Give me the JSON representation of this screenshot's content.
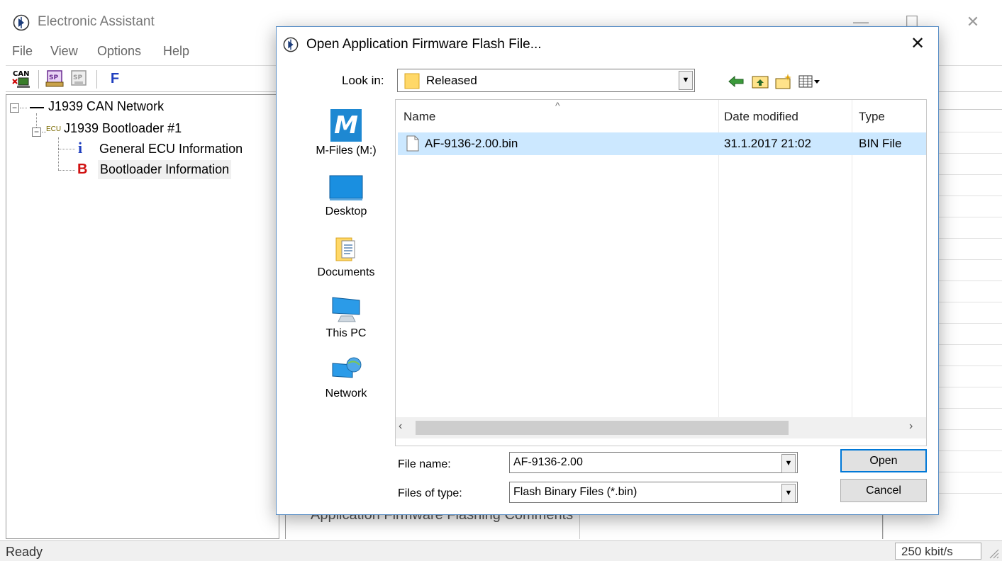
{
  "main_window": {
    "title": "Electronic Assistant",
    "menu": [
      "File",
      "View",
      "Options",
      "Help"
    ],
    "toolbar": {
      "f_button": "F"
    },
    "tree": {
      "root": "J1939 CAN Network",
      "ecu_tag": "ECU",
      "node": "J1939 Bootloader #1",
      "children": [
        {
          "icon": "i",
          "label": "General ECU Information"
        },
        {
          "icon": "B",
          "label": "Bootloader Information"
        }
      ]
    },
    "background_label": "Application Firmware Flashing Comments",
    "status": {
      "text": "Ready",
      "baud": "250 kbit/s"
    }
  },
  "dialog": {
    "title": "Open Application Firmware Flash File...",
    "look_in_label": "Look in:",
    "look_in_value": "Released",
    "places": [
      "M-Files (M:)",
      "Desktop",
      "Documents",
      "This PC",
      "Network"
    ],
    "places_m_glyph": "M",
    "columns": [
      "Name",
      "Date modified",
      "Type"
    ],
    "files": [
      {
        "name": "AF-9136-2.00.bin",
        "date": "31.1.2017 21:02",
        "type": "BIN File"
      }
    ],
    "file_name_label": "File name:",
    "file_name_value": "AF-9136-2.00",
    "file_type_label": "Files of type:",
    "file_type_value": "Flash Binary Files (*.bin)",
    "open_button": "Open",
    "cancel_button": "Cancel"
  },
  "colors": {
    "selection": "#cce8ff",
    "dialog_border": "#5a8fc6",
    "focus_border": "#0078d7"
  }
}
